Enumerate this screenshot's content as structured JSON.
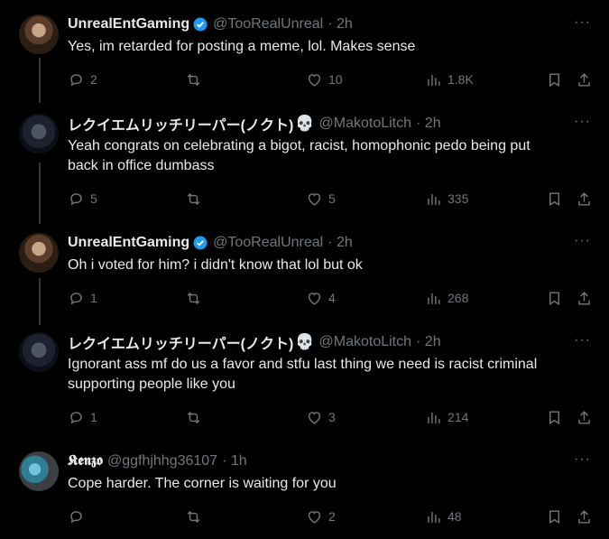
{
  "tweets": [
    {
      "display_name": "UnrealEntGaming",
      "handle": "@TooRealUnreal",
      "time": "· 2h",
      "text_lines": [
        "Yes, im retarded for posting a meme, lol. Makes sense"
      ],
      "replies": "2",
      "retweets": "",
      "likes": "10",
      "views": "1.8K"
    },
    {
      "display_name": "レクイエムリッチリーパー(ノクト)",
      "handle": "@MakotoLitch",
      "time": "· 2h",
      "text_lines": [
        "Yeah congrats on celebrating a bigot, racist, homophonic pedo being put",
        "back in office dumbass"
      ],
      "replies": "5",
      "retweets": "",
      "likes": "5",
      "views": "335"
    },
    {
      "display_name": "UnrealEntGaming",
      "handle": "@TooRealUnreal",
      "time": "· 2h",
      "text_lines": [
        "Oh i voted for him? i didn't know that lol but ok"
      ],
      "replies": "1",
      "retweets": "",
      "likes": "4",
      "views": "268"
    },
    {
      "display_name": "レクイエムリッチリーパー(ノクト)",
      "handle": "@MakotoLitch",
      "time": "· 2h",
      "text_lines": [
        "Ignorant ass mf do us a favor and stfu last thing we need is racist  criminal",
        "supporting people like you"
      ],
      "replies": "1",
      "retweets": "",
      "likes": "3",
      "views": "214"
    },
    {
      "display_name": "𝕶𝖊𝖓𝖟𝖔",
      "handle": "@ggfhjhhg36107",
      "time": "· 1h",
      "text_lines": [
        "Cope harder. The corner is waiting for you"
      ],
      "replies": "",
      "retweets": "",
      "likes": "2",
      "views": "48"
    }
  ],
  "colors": {
    "background": "#000000",
    "text_primary": "#e7e9ea",
    "text_secondary": "#71767b",
    "verified_blue": "#1d9bf0",
    "thread_line": "#333639"
  },
  "icons": {
    "more": "more-horizontal-icon",
    "reply": "reply-icon",
    "retweet": "retweet-icon",
    "like": "heart-icon",
    "views": "views-icon",
    "bookmark": "bookmark-icon",
    "share": "share-icon",
    "verified": "verified-badge-icon",
    "skull": "skull-emoji"
  },
  "more_glyph": "···",
  "skull_glyph": "💀"
}
